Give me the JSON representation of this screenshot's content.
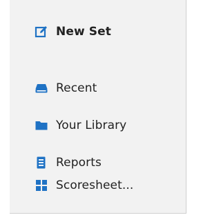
{
  "menu": {
    "accent_color": "#1f72c4",
    "items": [
      {
        "label": "New Set",
        "icon": "edit-square-icon",
        "emphasis": "bold"
      },
      {
        "label": "Recent",
        "icon": "hard-drive-icon"
      },
      {
        "label": "Your Library",
        "icon": "folder-icon"
      },
      {
        "label": "Reports",
        "icon": "document-list-icon"
      },
      {
        "label": "Scoresheet...",
        "icon": "grid-icon"
      }
    ]
  }
}
